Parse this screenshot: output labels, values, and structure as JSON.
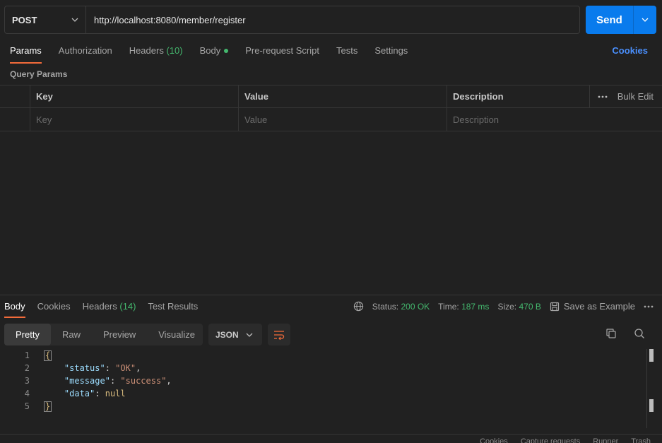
{
  "request": {
    "method": "POST",
    "url": "http://localhost:8080/member/register",
    "send_label": "Send"
  },
  "request_tabs": [
    {
      "label": "Params",
      "active": true
    },
    {
      "label": "Authorization"
    },
    {
      "label": "Headers",
      "count": "(10)"
    },
    {
      "label": "Body"
    },
    {
      "label": "Pre-request Script"
    },
    {
      "label": "Tests"
    },
    {
      "label": "Settings"
    }
  ],
  "cookies_link": "Cookies",
  "query_params": {
    "title": "Query Params",
    "headers": {
      "key": "Key",
      "value": "Value",
      "description": "Description",
      "bulk_edit": "Bulk Edit"
    },
    "placeholders": {
      "key": "Key",
      "value": "Value",
      "description": "Description"
    }
  },
  "response": {
    "tabs": [
      {
        "label": "Body",
        "active": true
      },
      {
        "label": "Cookies"
      },
      {
        "label": "Headers",
        "count": "(14)"
      },
      {
        "label": "Test Results"
      }
    ],
    "status_label": "Status:",
    "status_value": "200 OK",
    "time_label": "Time:",
    "time_value": "187 ms",
    "size_label": "Size:",
    "size_value": "470 B",
    "save_example": "Save as Example",
    "view_modes": [
      "Pretty",
      "Raw",
      "Preview",
      "Visualize"
    ],
    "format": "JSON",
    "code": {
      "line_numbers": [
        "1",
        "2",
        "3",
        "4",
        "5"
      ],
      "open_brace": "{",
      "close_brace": "}",
      "status_key": "\"status\"",
      "status_val": "\"OK\"",
      "message_key": "\"message\"",
      "message_val": "\"success\"",
      "data_key": "\"data\"",
      "data_val": "null"
    }
  },
  "footer": {
    "items": [
      "Cookies",
      "Capture requests",
      "Runner",
      "Trash"
    ]
  },
  "colors": {
    "background": "#212121",
    "accent": "#097bed",
    "active_tab_underline": "#f26b3a",
    "success": "#44b86e",
    "link": "#4a90ff"
  }
}
